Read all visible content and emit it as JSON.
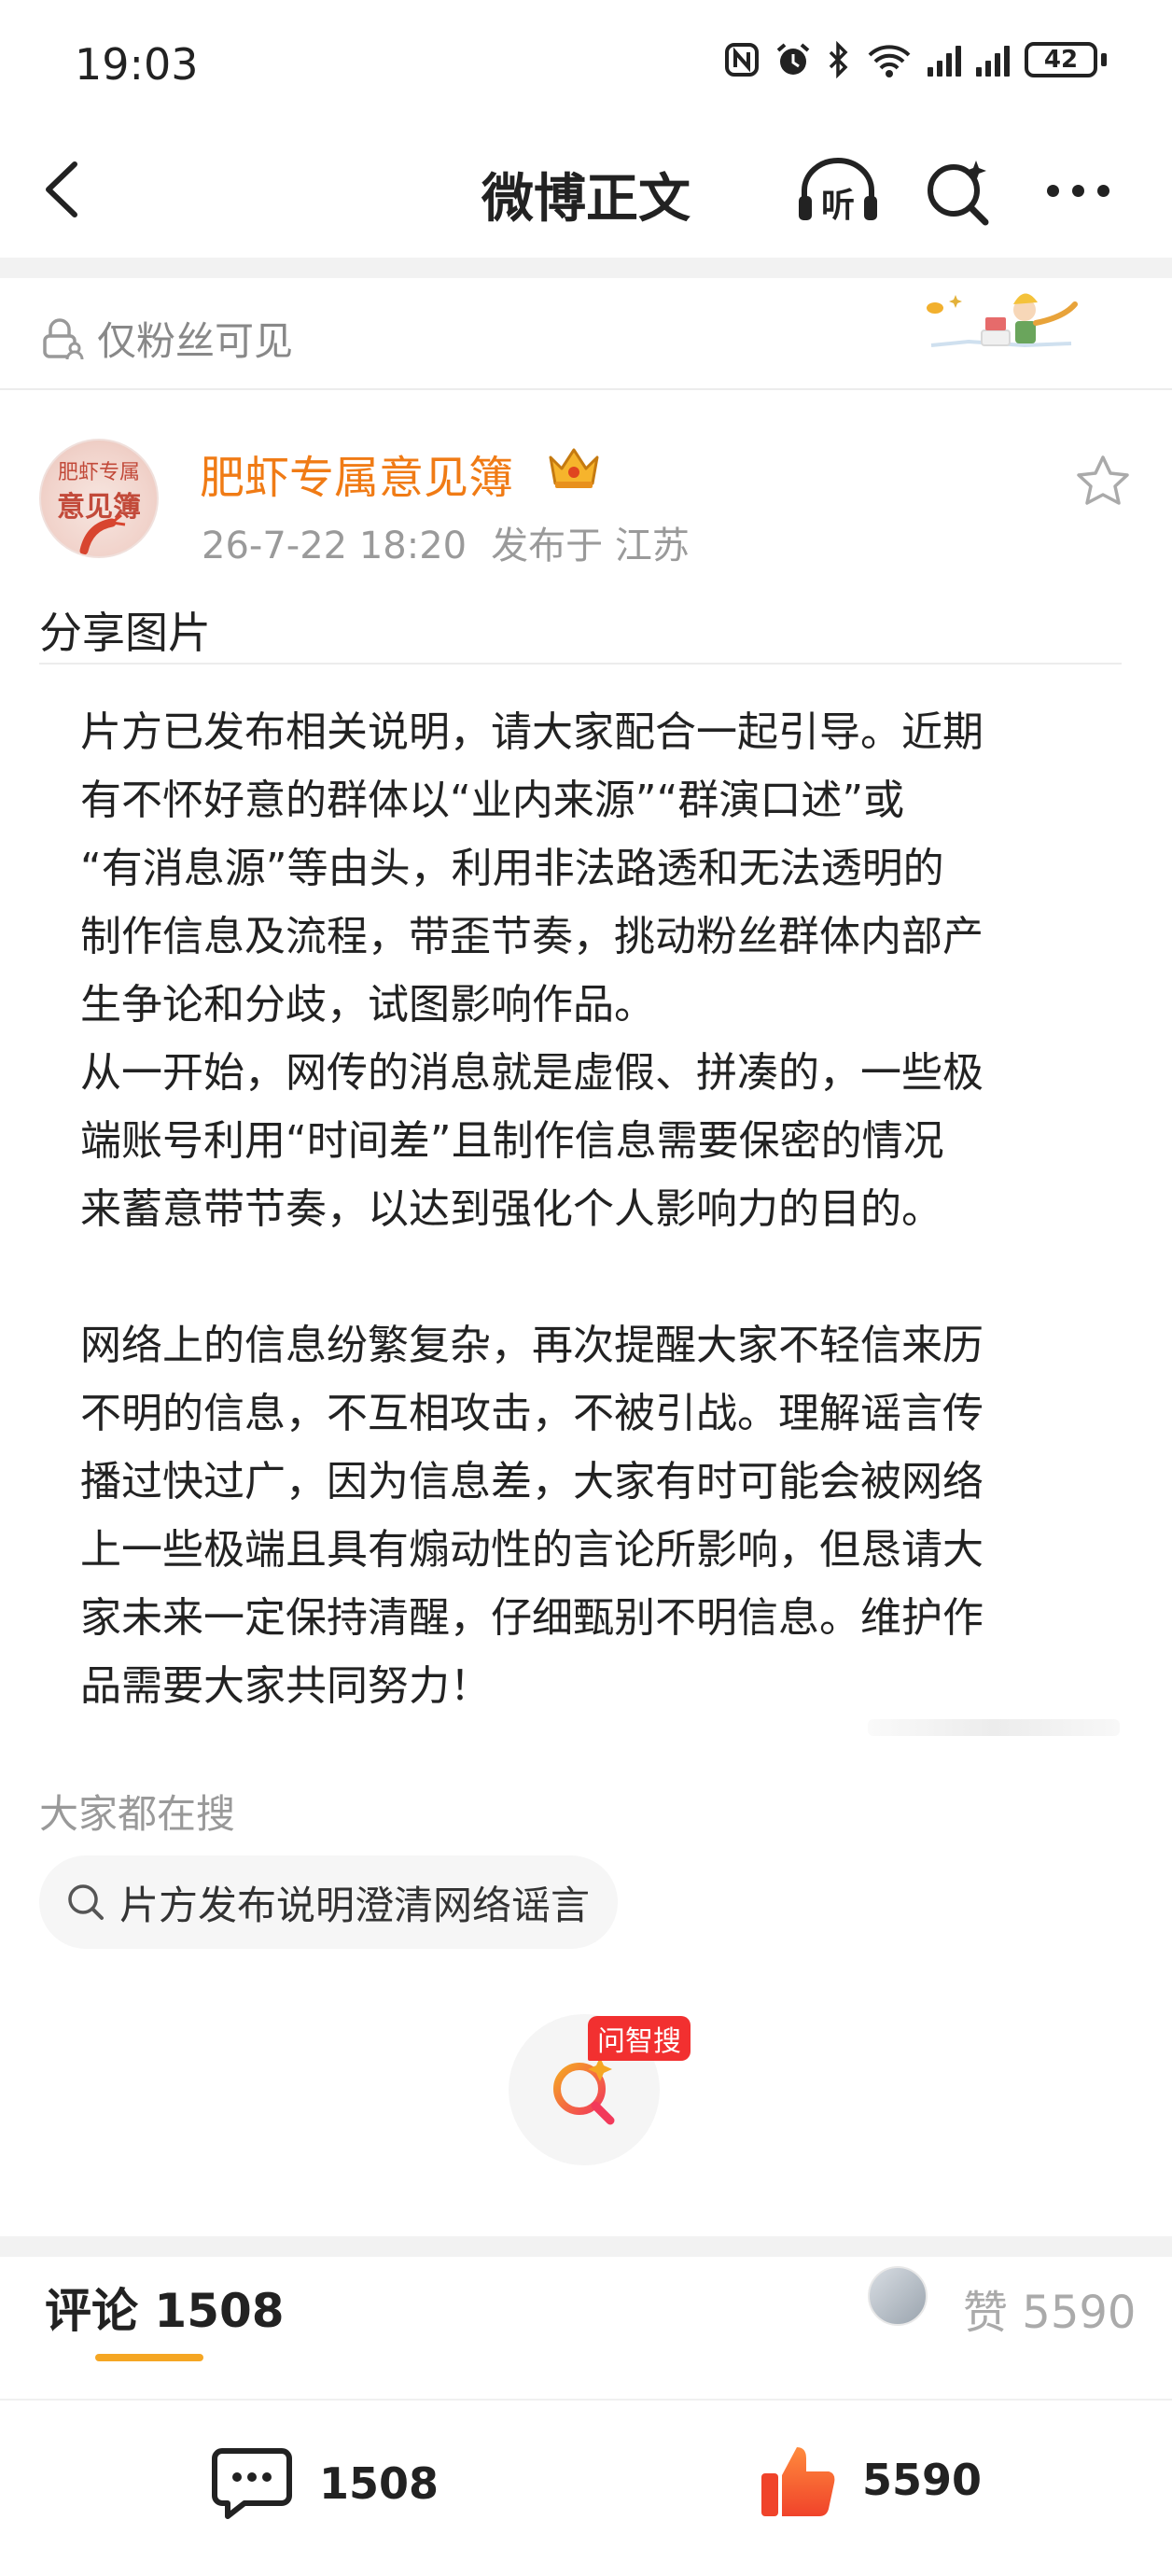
{
  "status_bar": {
    "time": "19:03",
    "battery": "42"
  },
  "nav": {
    "title": "微博正文",
    "listen_label": "听"
  },
  "visibility": {
    "label": "仅粉丝可见"
  },
  "author": {
    "name": "肥虾专属意见簿",
    "avatar_text_top": "肥虾专属",
    "avatar_text_bottom": "意见簿",
    "time": "26-7-22 18:20",
    "location": "发布于 江苏"
  },
  "post": {
    "share_label": "分享图片",
    "body": "片方已发布相关说明，请大家配合一起引导。近期\n有不怀好意的群体以“业内来源”“群演口述”或\n“有消息源”等由头，利用非法路透和无法透明的\n制作信息及流程，带歪节奏，挑动粉丝群体内部产\n生争论和分歧，试图影响作品。\n从一开始，网传的消息就是虚假、拼凑的，一些极\n端账号利用“时间差”且制作信息需要保密的情况\n来蓄意带节奏，以达到强化个人影响力的目的。\n\n网络上的信息纷繁复杂，再次提醒大家不轻信来历\n不明的信息，不互相攻击，不被引战。理解谣言传\n播过快过广，因为信息差，大家有时可能会被网络\n上一些极端且具有煽动性的言论所影响，但恳请大\n家未来一定保持清醒，仔细甄别不明信息。维护作\n品需要大家共同努力！"
  },
  "hot_search": {
    "label": "大家都在搜",
    "query": "片方发布说明澄清网络谣言"
  },
  "ai_search": {
    "badge": "问智搜"
  },
  "comments_header": {
    "tab_label": "评论",
    "count": "1508",
    "like_label": "赞",
    "like_count": "5590"
  },
  "bottom_bar": {
    "comment_count": "1508",
    "like_count": "5590"
  },
  "colors": {
    "accent_orange": "#f07b15",
    "tab_underline": "#f5a623",
    "badge_red": "#f23030"
  }
}
